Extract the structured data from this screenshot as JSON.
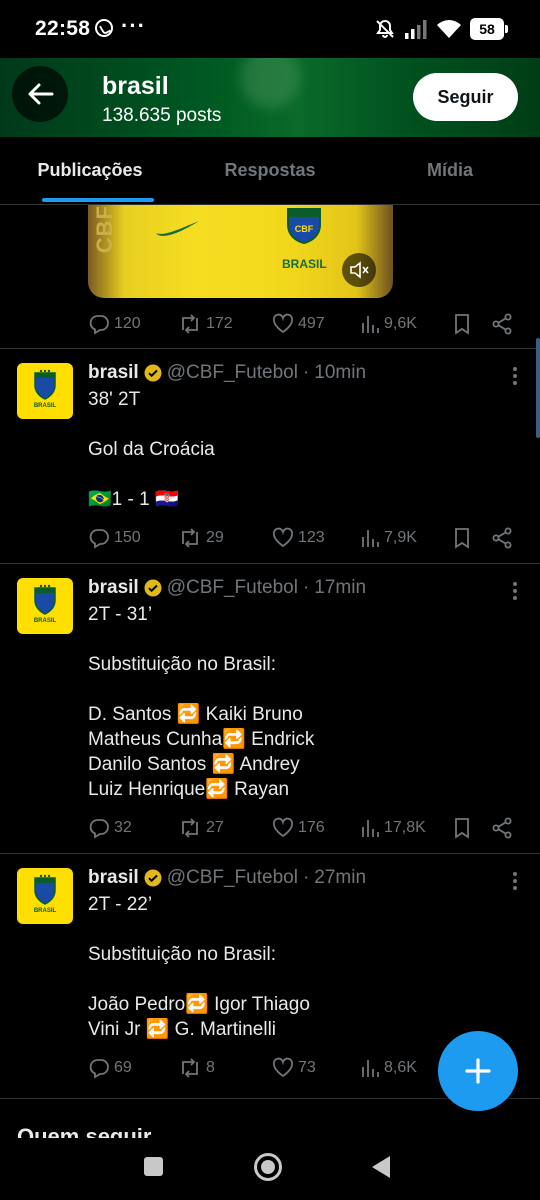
{
  "status_bar": {
    "time": "22:58",
    "dots": "···",
    "battery": "58",
    "icons": [
      "whatsapp-icon",
      "mute-bell-icon",
      "signal-icon",
      "wifi-icon",
      "battery-icon"
    ]
  },
  "header": {
    "title": "brasil",
    "post_count": "138.635 posts",
    "follow_label": "Seguir"
  },
  "tabs": [
    {
      "label": "Publicações",
      "active": true
    },
    {
      "label": "Respostas",
      "active": false
    },
    {
      "label": "Mídia",
      "active": false
    }
  ],
  "media_preview": {
    "side_text": "CBF",
    "crest_label": "BRASIL",
    "crest_text": "CBF"
  },
  "posts": [
    {
      "name": "brasil",
      "handle": "@CBF_Futebol",
      "time": "10min",
      "body": "38' 2T\n\nGol da Croácia\n\n🇧🇷1 - 1 🇭🇷",
      "replies": "150",
      "reposts": "29",
      "likes": "123",
      "views": "7,9K"
    },
    {
      "name": "brasil",
      "handle": "@CBF_Futebol",
      "time": "17min",
      "body": "2T - 31’\n\nSubstituição no Brasil:\n\nD. Santos 🔁 Kaiki Bruno\nMatheus Cunha🔁 Endrick\nDanilo Santos 🔁 Andrey\nLuiz Henrique🔁 Rayan",
      "replies": "32",
      "reposts": "27",
      "likes": "176",
      "views": "17,8K"
    },
    {
      "name": "brasil",
      "handle": "@CBF_Futebol",
      "time": "27min",
      "body": "2T - 22’\n\nSubstituição no Brasil:\n\nJoão Pedro🔁 Igor Thiago\nVini Jr 🔁 G. Martinelli",
      "replies": "69",
      "reposts": "8",
      "likes": "73",
      "views": "8,6K"
    }
  ],
  "first_post_stats": {
    "replies": "120",
    "reposts": "172",
    "likes": "497",
    "views": "9,6K"
  },
  "avatar_label": "BRASIL",
  "section_title": "Quem seguir",
  "colors": {
    "accent": "#1d9bf0",
    "muted": "#71767b",
    "verified_gold": "#e2b719",
    "header_green": "#005a22",
    "avatar_yellow": "#ffdf00"
  }
}
